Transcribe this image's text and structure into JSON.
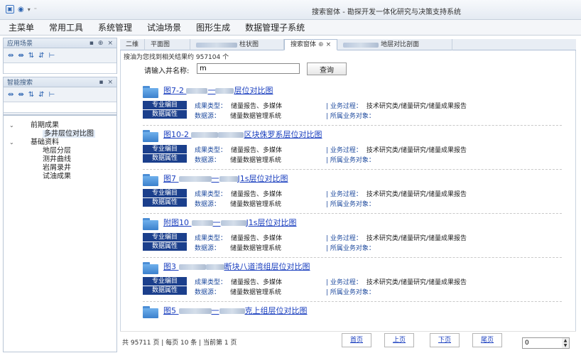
{
  "window": {
    "title": "搜索窗体 - 勘探开发一体化研究与决策支持系统"
  },
  "menu": [
    "主菜单",
    "常用工具",
    "系统管理",
    "试油场景",
    "图形生成",
    "数据管理子系统"
  ],
  "panels": {
    "app_scene": {
      "title": "应用场景"
    },
    "smart_search": {
      "title": "智能搜索"
    }
  },
  "tree": [
    {
      "label": "前期成果",
      "level": 1,
      "expanded": true
    },
    {
      "label": "多井层位对比图",
      "level": 2,
      "selected": true
    },
    {
      "label": "基础资料",
      "level": 1,
      "expanded": true
    },
    {
      "label": "地层分层",
      "level": 2
    },
    {
      "label": "测井曲线",
      "level": 2
    },
    {
      "label": "岩屑录井",
      "level": 2
    },
    {
      "label": "试油成果",
      "level": 2
    }
  ],
  "tabs": [
    {
      "label": "二维"
    },
    {
      "label": "平面图"
    },
    {
      "label": "柱状图"
    },
    {
      "label": "搜索窗体",
      "active": true,
      "pin": "⊕",
      "close": "×"
    },
    {
      "label": "地层对比剖面"
    }
  ],
  "search": {
    "summary": "搜油为您找到相关结果约 957104 个",
    "label": "请输入井名称:",
    "value": "m",
    "button": "查询"
  },
  "result_fields": {
    "badge1": "专业编目",
    "badge2": "数据属性",
    "type_key": "成果类型：",
    "type_val": "储量报告、多媒体",
    "source_key": "数据源：",
    "source_val": "储量数据管理系统",
    "process_key": "| 业务过程：",
    "process_val": "技术研究类/储量研究/储量成果报告",
    "object_key": "| 所属业务对象："
  },
  "results": [
    {
      "prefix": "图7-2 ",
      "suffix": "层位对比图",
      "mid": "一"
    },
    {
      "prefix": "图10-2 ",
      "suffix": "区块侏罗系层位对比图",
      "mid": ""
    },
    {
      "prefix": "图7 ",
      "suffix": "J1s层位对比图",
      "mid": "一"
    },
    {
      "prefix": "附图10 ",
      "suffix": "J1s层位对比图",
      "mid": "一"
    },
    {
      "prefix": "图3 ",
      "suffix": "断块八道湾组层位对比图",
      "mid": ""
    },
    {
      "prefix": "图5 ",
      "suffix": "克上组层位对比图",
      "mid": "一"
    }
  ],
  "pager": {
    "info": "共 95711 页 | 每页 10 条 | 当前第 1 页",
    "first": "首页",
    "prev": "上页",
    "next": "下页",
    "last": "尾页",
    "page_value": "0"
  },
  "colors": {
    "link": "#1a3fbf",
    "badge": "#1b3f8c",
    "accent": "#2a62b0"
  }
}
